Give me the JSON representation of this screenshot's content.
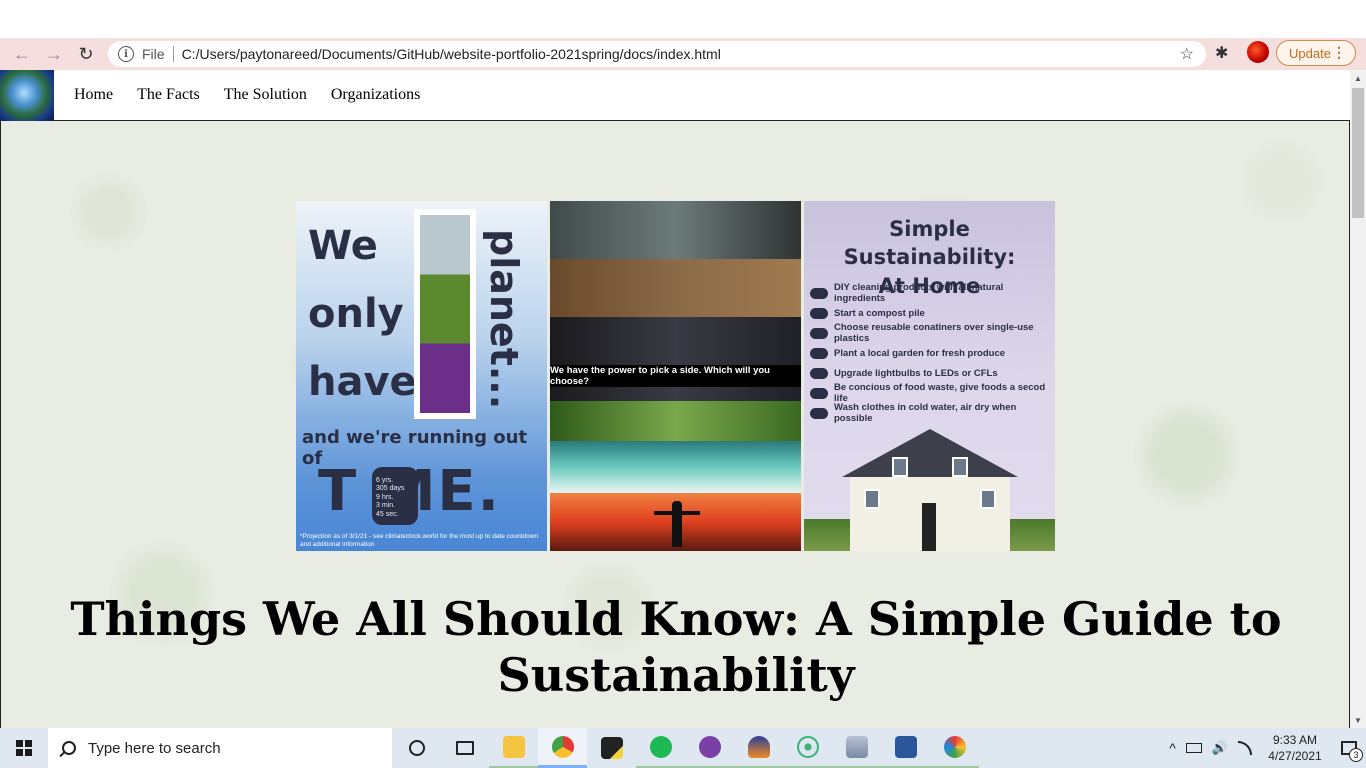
{
  "browser": {
    "url_scheme": "File",
    "url": "C:/Users/paytonareed/Documents/GitHub/website-portfolio-2021spring/docs/index.html",
    "update_label": "Update",
    "more_glyph": "⋮",
    "back_glyph": "←",
    "forward_glyph": "→",
    "reload_glyph": "↻",
    "info_glyph": "i",
    "star_glyph": "☆",
    "extension_glyph": "✱"
  },
  "nav": {
    "links": [
      "Home",
      "The Facts",
      "The Solution",
      "Organizations"
    ]
  },
  "posters": {
    "planet": {
      "line1": "We",
      "line2": "only",
      "line3": "have",
      "vertical": "planet...",
      "running": "and we're running out of",
      "time": "T  ME.",
      "watch": "6 yrs.\n305 days\n9 hrs.\n3 min.\n45 sec.",
      "projection": "*Projection as of 3/1/21 - see climateclock.world for the most up to date countdown and additional information"
    },
    "choose": {
      "caption": "We have the power to pick a side. Which will you choose?"
    },
    "home": {
      "title_line1": "Simple Sustainability:",
      "title_line2": "At Home",
      "items": [
        "DIY cleaning products with all natural ingredients",
        "Start a compost pile",
        "Choose reusable conatiners over single-use plastics",
        "Plant a local garden for fresh produce",
        "Upgrade lightbulbs to LEDs or CFLs",
        "Be concious of food waste, give foods a secod life",
        "Wash clothes in cold water, air dry when possible"
      ]
    }
  },
  "headline": "Things We All Should Know: A Simple Guide to Sustainability",
  "taskbar": {
    "search_placeholder": "Type here to search",
    "time": "9:33 AM",
    "date": "4/27/2021",
    "notification_count": "3",
    "tray_up_glyph": "^",
    "volume_glyph": "🔊",
    "scroll_up_glyph": "▲",
    "scroll_down_glyph": "▼"
  },
  "colors": {
    "toolbar": "#f4dede",
    "update_accent": "#c26a1c",
    "taskbar": "#dfe7f1",
    "headline": "#000000"
  }
}
